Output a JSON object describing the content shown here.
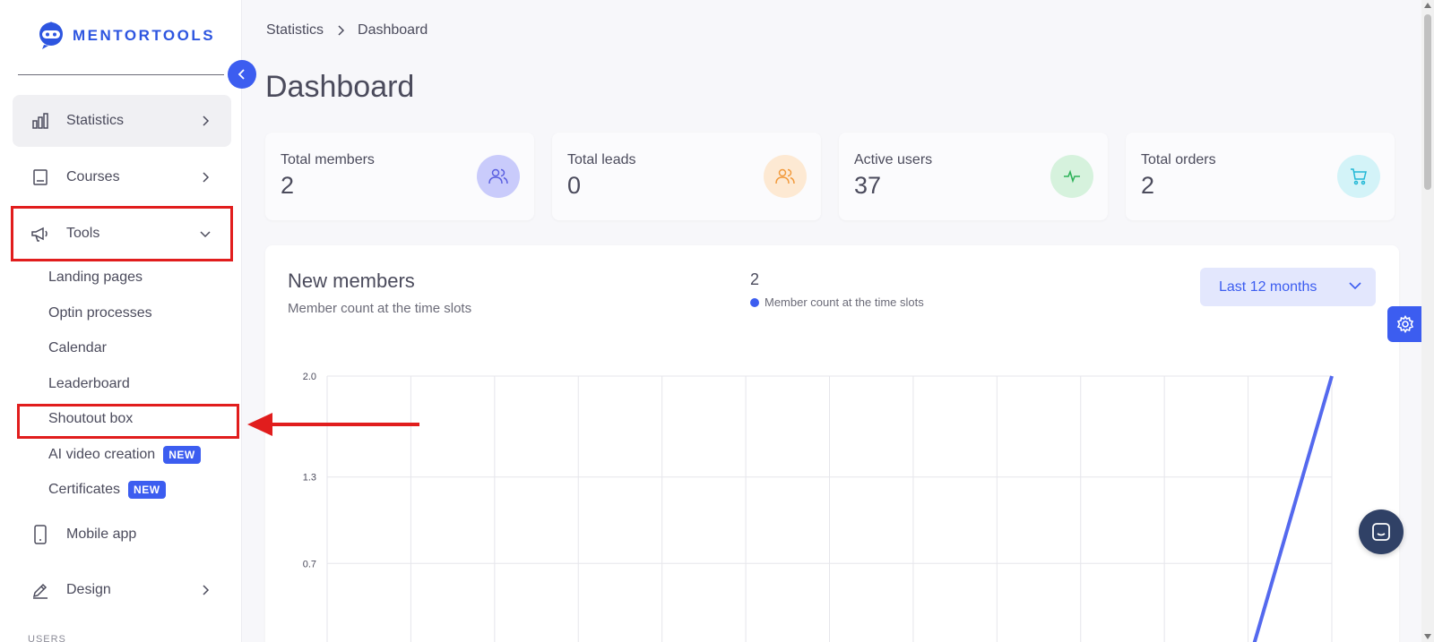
{
  "brand": {
    "name": "MENTORTOOLS",
    "accent": "#3c5df0"
  },
  "sidebar": {
    "items": [
      {
        "label": "Statistics",
        "icon": "bar-chart-icon"
      },
      {
        "label": "Courses",
        "icon": "book-icon"
      },
      {
        "label": "Tools",
        "icon": "megaphone-icon"
      },
      {
        "label": "Mobile app",
        "icon": "mobile-icon"
      },
      {
        "label": "Design",
        "icon": "pencil-icon"
      }
    ],
    "tools_sub": [
      {
        "label": "Landing pages"
      },
      {
        "label": "Optin processes"
      },
      {
        "label": "Calendar"
      },
      {
        "label": "Leaderboard"
      },
      {
        "label": "Shoutout box"
      },
      {
        "label": "AI video creation",
        "badge": "NEW"
      },
      {
        "label": "Certificates",
        "badge": "NEW"
      }
    ],
    "section_users": "USERS"
  },
  "breadcrumb": {
    "parent": "Statistics",
    "current": "Dashboard"
  },
  "page_title": "Dashboard",
  "stats": [
    {
      "label": "Total members",
      "value": "2",
      "icon": "users-icon",
      "color": "#c9cbfb"
    },
    {
      "label": "Total leads",
      "value": "0",
      "icon": "users-icon",
      "color": "#fde9d3"
    },
    {
      "label": "Active users",
      "value": "37",
      "icon": "activity-icon",
      "color": "#d6f2dd"
    },
    {
      "label": "Total orders",
      "value": "2",
      "icon": "cart-icon",
      "color": "#d3f3f8"
    }
  ],
  "chart_card": {
    "title": "New members",
    "subtitle": "Member count at the time slots",
    "total": "2",
    "legend": "Member count at the time slots",
    "range": "Last 12 months"
  },
  "chart_data": {
    "type": "line",
    "title": "New members",
    "yticks": [
      "2.0",
      "1.3",
      "0.7"
    ],
    "ylim": [
      0,
      2
    ],
    "x_count": 13,
    "series": [
      {
        "name": "Member count at the time slots",
        "values": [
          0,
          0,
          0,
          0,
          0,
          0,
          0,
          0,
          0,
          0,
          0,
          0,
          2
        ]
      }
    ],
    "grid": true
  }
}
